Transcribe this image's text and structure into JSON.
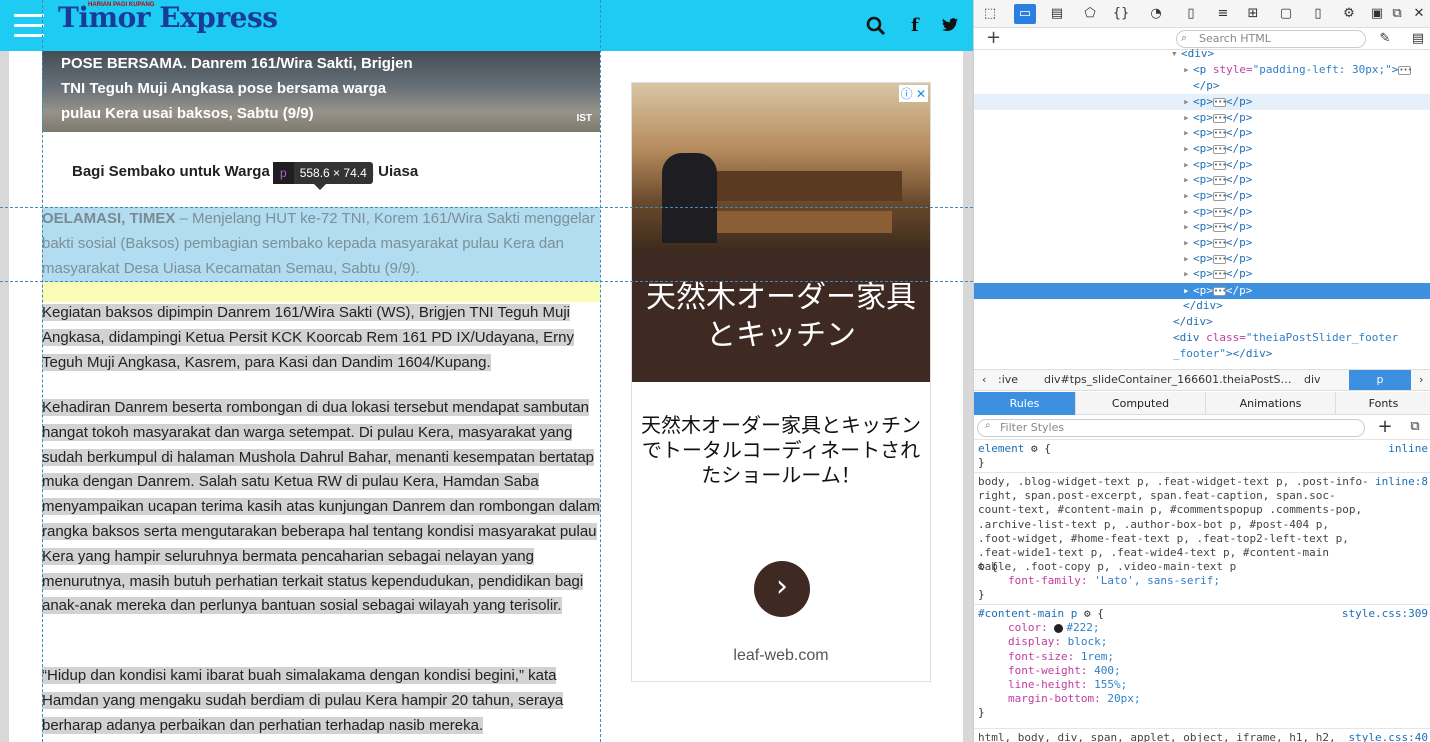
{
  "site": {
    "logo": "Timor Express",
    "logo_tagline": "HARIAN PAGI KUPANG",
    "icons": {
      "menu": "hamburger-icon",
      "search": "search-icon",
      "facebook": "facebook-icon",
      "twitter": "twitter-icon"
    },
    "search_glyph": "🔍",
    "facebook_glyph": "f",
    "twitter_glyph": "𝕥",
    "photo_caption": "POSE BERSAMA. Danrem 161/Wira Sakti, Brigjen TNI Teguh Muji Angkasa pose bersama warga pulau Kera usai baksos, Sabtu (9/9)",
    "photo_credit": "IST",
    "subhead": "Bagi Sembako untuk Warga",
    "subhead_tail": "n Uiasa",
    "inspector_tooltip": {
      "tag": "p",
      "size": "558.6 × 74.4"
    },
    "lead_dateline": "OELAMASI, TIMEX",
    "lead_text": " – Menjelang HUT ke-72 TNI, Korem 161/Wira Sakti menggelar bakti sosial (Baksos) pembagian sembako kepada masyarakat pulau Kera dan masyarakat Desa Uiasa Kecamatan Semau, Sabtu (9/9).",
    "para2": "Kegiatan baksos dipimpin Danrem 161/Wira Sakti (WS), Brigjen TNI Teguh Muji Angkasa, didampingi Ketua Persit KCK Koorcab Rem 161 PD IX/Udayana, Erny Teguh Muji Angkasa, Kasrem, para Kasi dan Dandim 1604/Kupang.",
    "para3": "Kehadiran Danrem beserta rombongan di dua lokasi tersebut mendapat sambutan hangat tokoh masyarakat dan warga setempat. Di pulau Kera, masyarakat yang sudah berkumpul di halaman Mushola Dahrul Bahar, menanti kesempatan bertatap muka dengan Danrem. Salah satu Ketua RW di pulau Kera, Hamdan Saba menyampaikan ucapan terima kasih atas kunjungan Danrem dan rombongan dalam rangka baksos serta mengutarakan beberapa hal tentang kondisi masyarakat pulau Kera yang hampir seluruhnya bermata pencaharian sebagai nelayan yang menurutnya, masih butuh perhatian terkait status kependudukan, pendidikan bagi anak-anak mereka dan perlunya bantuan sosial sebagai wilayah yang terisolir.",
    "para4": "“Hidup dan kondisi kami ibarat buah simalakama dengan kondisi begini,” kata Hamdan yang mengaku sudah berdiam di pulau Kera hampir 20 tahun, seraya berharap adanya perbaikan dan perhatian terhadap nasib mereka."
  },
  "ad": {
    "badge": "ⓘ ✕",
    "headline": "天然木オーダー家具とキッチン",
    "description": "天然木オーダー家具とキッチンでトータルコーディネートされたショールーム！",
    "cta": "›",
    "domain": "leaf-web.com"
  },
  "devtools": {
    "toolbar_icons": [
      "pick-element-icon",
      "responsive-icon",
      "console-icon",
      "debugger-icon",
      "style-editor-icon",
      "performance-icon",
      "memory-icon",
      "network-icon",
      "storage-icon",
      "layout-icon",
      "screenshot-icon",
      "phone-icon",
      "settings-icon",
      "dock-icon",
      "popout-icon",
      "close-icon"
    ],
    "search_placeholder": "Search HTML",
    "tree": [
      "<div>",
      "<p style=\"padding-left: 30px;\">",
      "</p>",
      "<p>…</p>",
      "<p>…</p>",
      "<p>…</p>",
      "<p>…</p>",
      "<p>…</p>",
      "<p>…</p>",
      "<p>…</p>",
      "<p>…</p>",
      "<p>…</p>",
      "<p>…</p>",
      "<p>…</p>",
      "<p>…</p>",
      "</div>",
      "</div>",
      "<div class=\"theiaPostSlider_footer _footer\"></div>"
    ],
    "breadcrumbs": [
      "‹",
      ":ive",
      "div#tps_slideContainer_166601.theiaPostS…",
      "div",
      "p",
      "›"
    ],
    "tabs": [
      "Rules",
      "Computed",
      "Animations",
      "Fonts"
    ],
    "filter_placeholder": "Filter Styles",
    "rules": {
      "element_selector": "element",
      "element_source": "inline",
      "r2_selector": "body, .blog-widget-text p, .feat-widget-text p, .post-info-right, span.post-excerpt, span.feat-caption, span.soc-count-text, #content-main p, #commentspopup .comments-pop, .archive-list-text p, .author-box-bot p, #post-404 p, .foot-widget, #home-feat-text p, .feat-top2-left-text p, .feat-wide1-text p, .feat-wide4-text p, #content-main table, .foot-copy p, .video-main-text p",
      "r2_source": "inline:8",
      "r2_prop": "font-family",
      "r2_value": "'Lato', sans-serif;",
      "r3_selector": "#content-main p",
      "r3_source": "style.css:309",
      "r3_props": [
        {
          "name": "color",
          "value": "#222;"
        },
        {
          "name": "display",
          "value": "block;"
        },
        {
          "name": "font-size",
          "value": "1rem;"
        },
        {
          "name": "font-weight",
          "value": "400;"
        },
        {
          "name": "line-height",
          "value": "155%;"
        },
        {
          "name": "margin-bottom",
          "value": "20px;"
        }
      ],
      "r4_selector": "html, body, div, span, applet, object, iframe, h1, h2,",
      "r4_source": "style.css:40"
    }
  }
}
